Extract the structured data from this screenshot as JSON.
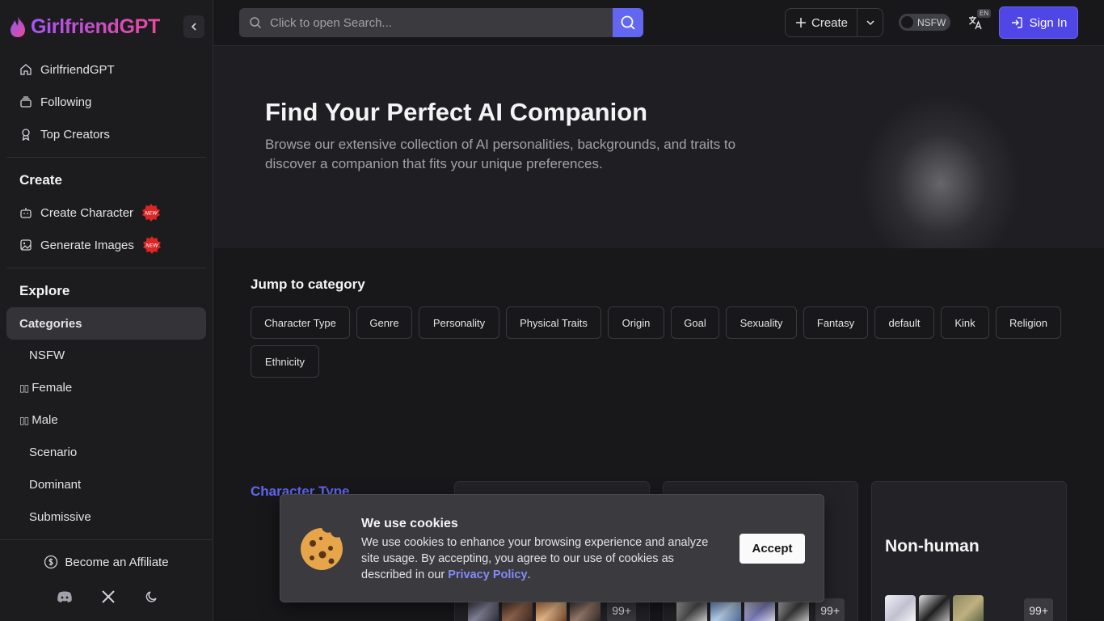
{
  "brand": {
    "name": "GirlfriendGPT"
  },
  "sidebar": {
    "top_items": [
      {
        "label": "GirlfriendGPT",
        "icon": "home-icon"
      },
      {
        "label": "Following",
        "icon": "stack-icon"
      },
      {
        "label": "Top Creators",
        "icon": "award-icon"
      }
    ],
    "create_title": "Create",
    "create_items": [
      {
        "label": "Create Character",
        "badge": "NEW"
      },
      {
        "label": "Generate Images",
        "badge": "NEW"
      }
    ],
    "explore_title": "Explore",
    "explore_active": "Categories",
    "explore_items": [
      "NSFW",
      "Female",
      "Male",
      "Scenario",
      "Dominant",
      "Submissive"
    ],
    "footer": {
      "affiliate": "Become an Affiliate"
    }
  },
  "header": {
    "search_placeholder": "Click to open Search...",
    "create_label": "Create",
    "nsfw_label": "NSFW",
    "lang_code": "EN",
    "signin_label": "Sign In"
  },
  "hero": {
    "title": "Find Your Perfect AI Companion",
    "subtitle": "Browse our extensive collection of AI personalities, backgrounds, and traits to discover a companion that fits your unique preferences."
  },
  "categories": {
    "jump_title": "Jump to category",
    "chips": [
      "Character Type",
      "Genre",
      "Personality",
      "Physical Traits",
      "Origin",
      "Goal",
      "Sexuality",
      "Fantasy",
      "default",
      "Kink",
      "Religion",
      "Ethnicity"
    ],
    "section_heading": "Character Type",
    "cards": [
      {
        "title": "",
        "count": "99+"
      },
      {
        "title": "",
        "count": "99+"
      },
      {
        "title": "Non-human",
        "count": "99+"
      }
    ]
  },
  "cookie": {
    "title": "We use cookies",
    "body": "We use cookies to enhance your browsing experience and analyze site usage. By accepting, you agree to our use of cookies as described in our",
    "link": "Privacy Policy",
    "accept": "Accept"
  },
  "colors": {
    "accent": "#6366f1",
    "brand": "#e879b5",
    "signin": "#4f46e5"
  }
}
